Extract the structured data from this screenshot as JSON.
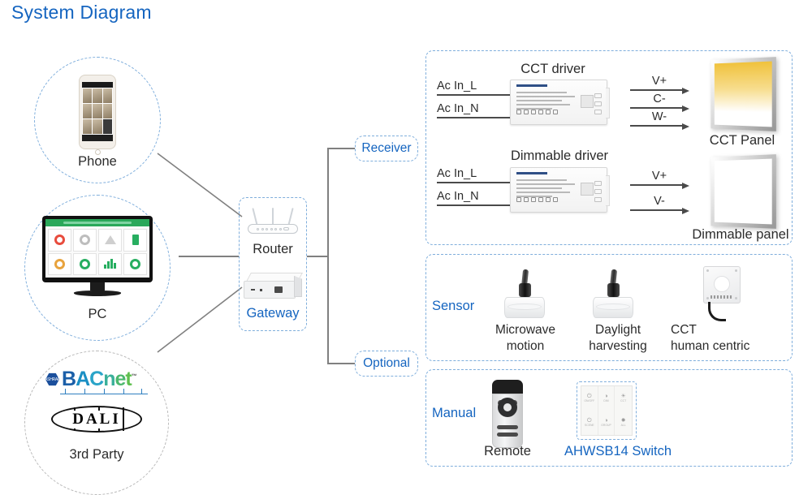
{
  "title": "System Diagram",
  "colors": {
    "accent_blue": "#1565C0",
    "dash_blue": "#7FAEDC",
    "line_gray": "#808080",
    "cct_warm": "#f0c23c"
  },
  "sources": {
    "phone": {
      "label": "Phone"
    },
    "pc": {
      "label": "PC"
    },
    "third_party": {
      "label": "3rd Party",
      "logos": [
        {
          "name": "BACnet",
          "mark": "ASHRAE",
          "text": "BACnet",
          "tm": "™"
        },
        {
          "name": "DALI",
          "text": "DALI"
        }
      ]
    }
  },
  "hub": {
    "router_label": "Router",
    "gateway_label": "Gateway"
  },
  "branches": {
    "receiver_tag": "Receiver",
    "optional_tag": "Optional"
  },
  "receiver": {
    "rows": [
      {
        "driver_title": "CCT driver",
        "inputs": [
          "Ac In_L",
          "Ac In_N"
        ],
        "outputs": [
          "V+",
          "C-",
          "W-"
        ],
        "panel_label": "CCT Panel",
        "panel_type": "cct"
      },
      {
        "driver_title": "Dimmable driver",
        "inputs": [
          "Ac In_L",
          "Ac In_N"
        ],
        "outputs": [
          "V+",
          "V-"
        ],
        "panel_label": "Dimmable panel",
        "panel_type": "plain"
      }
    ]
  },
  "sensor_section": {
    "label": "Sensor",
    "items": [
      {
        "name": "microwave-motion-sensor",
        "line1": "Microwave",
        "line2": "motion"
      },
      {
        "name": "daylight-harvesting-sensor",
        "line1": "Daylight",
        "line2": "harvesting"
      },
      {
        "name": "cct-human-centric-sensor",
        "line1": "CCT",
        "line2": "human centric"
      }
    ]
  },
  "manual_section": {
    "label": "Manual",
    "items": [
      {
        "name": "remote",
        "label": "Remote",
        "highlight": false
      },
      {
        "name": "ahwsb14-switch",
        "label": "AHWSB14 Switch",
        "highlight": true
      }
    ]
  },
  "switch_keys": [
    {
      "glyph": "⏻",
      "text": "ON/OFF"
    },
    {
      "glyph": "◑",
      "text": "DIM"
    },
    {
      "glyph": "☀",
      "text": "CCT"
    },
    {
      "glyph": "⏻",
      "text": "SCENE"
    },
    {
      "glyph": "◑",
      "text": "GROUP"
    },
    {
      "glyph": "✹",
      "text": "ALL"
    }
  ]
}
